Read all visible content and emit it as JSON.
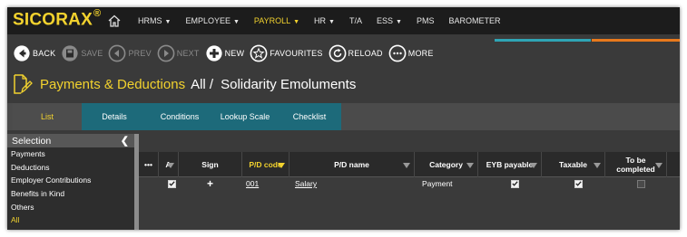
{
  "app": {
    "logo": "SICORAX",
    "logo_mark": "®"
  },
  "nav": {
    "items": [
      {
        "label": "HRMS",
        "dropdown": true,
        "active": false
      },
      {
        "label": "EMPLOYEE",
        "dropdown": true,
        "active": false
      },
      {
        "label": "PAYROLL",
        "dropdown": true,
        "active": true
      },
      {
        "label": "HR",
        "dropdown": true,
        "active": false
      },
      {
        "label": "T/A",
        "dropdown": false,
        "active": false
      },
      {
        "label": "ESS",
        "dropdown": true,
        "active": false
      },
      {
        "label": "PMS",
        "dropdown": false,
        "active": false
      },
      {
        "label": "BAROMETER",
        "dropdown": false,
        "active": false
      }
    ]
  },
  "toolbar": {
    "back": "BACK",
    "save": "SAVE",
    "prev": "PREV",
    "next": "NEXT",
    "new": "NEW",
    "favourites": "FAVOURITES",
    "reload": "RELOAD",
    "more": "MORE"
  },
  "page": {
    "title": "Payments & Deductions",
    "separator": "All /",
    "subtitle": "Solidarity Emoluments"
  },
  "tabs": [
    "List",
    "Details",
    "Conditions",
    "Lookup Scale",
    "Checklist"
  ],
  "sidebar": {
    "header": "Selection",
    "items": [
      "Payments",
      "Deductions",
      "Employer Contributions",
      "Benefits in Kind",
      "Others",
      "All"
    ]
  },
  "grid": {
    "columns": {
      "menu": "•••",
      "a": "A",
      "sign": "Sign",
      "pd_code": "P/D code",
      "pd_name": "P/D name",
      "category": "Category",
      "eyb_payable": "EYB payable",
      "taxable": "Taxable",
      "to_be_completed": "To be completed"
    },
    "rows": [
      {
        "a": true,
        "sign": "+",
        "pd_code": "001",
        "pd_name": "Salary",
        "category": "Payment",
        "eyb_payable": true,
        "taxable": true,
        "to_be_completed": false
      }
    ]
  },
  "colors": {
    "accent_yellow": "#f2d22e",
    "tab_teal": "#1d6a7a",
    "bar_teal": "#2fa5b5",
    "bar_orange": "#e8791c",
    "background": "#3a3a3a"
  }
}
